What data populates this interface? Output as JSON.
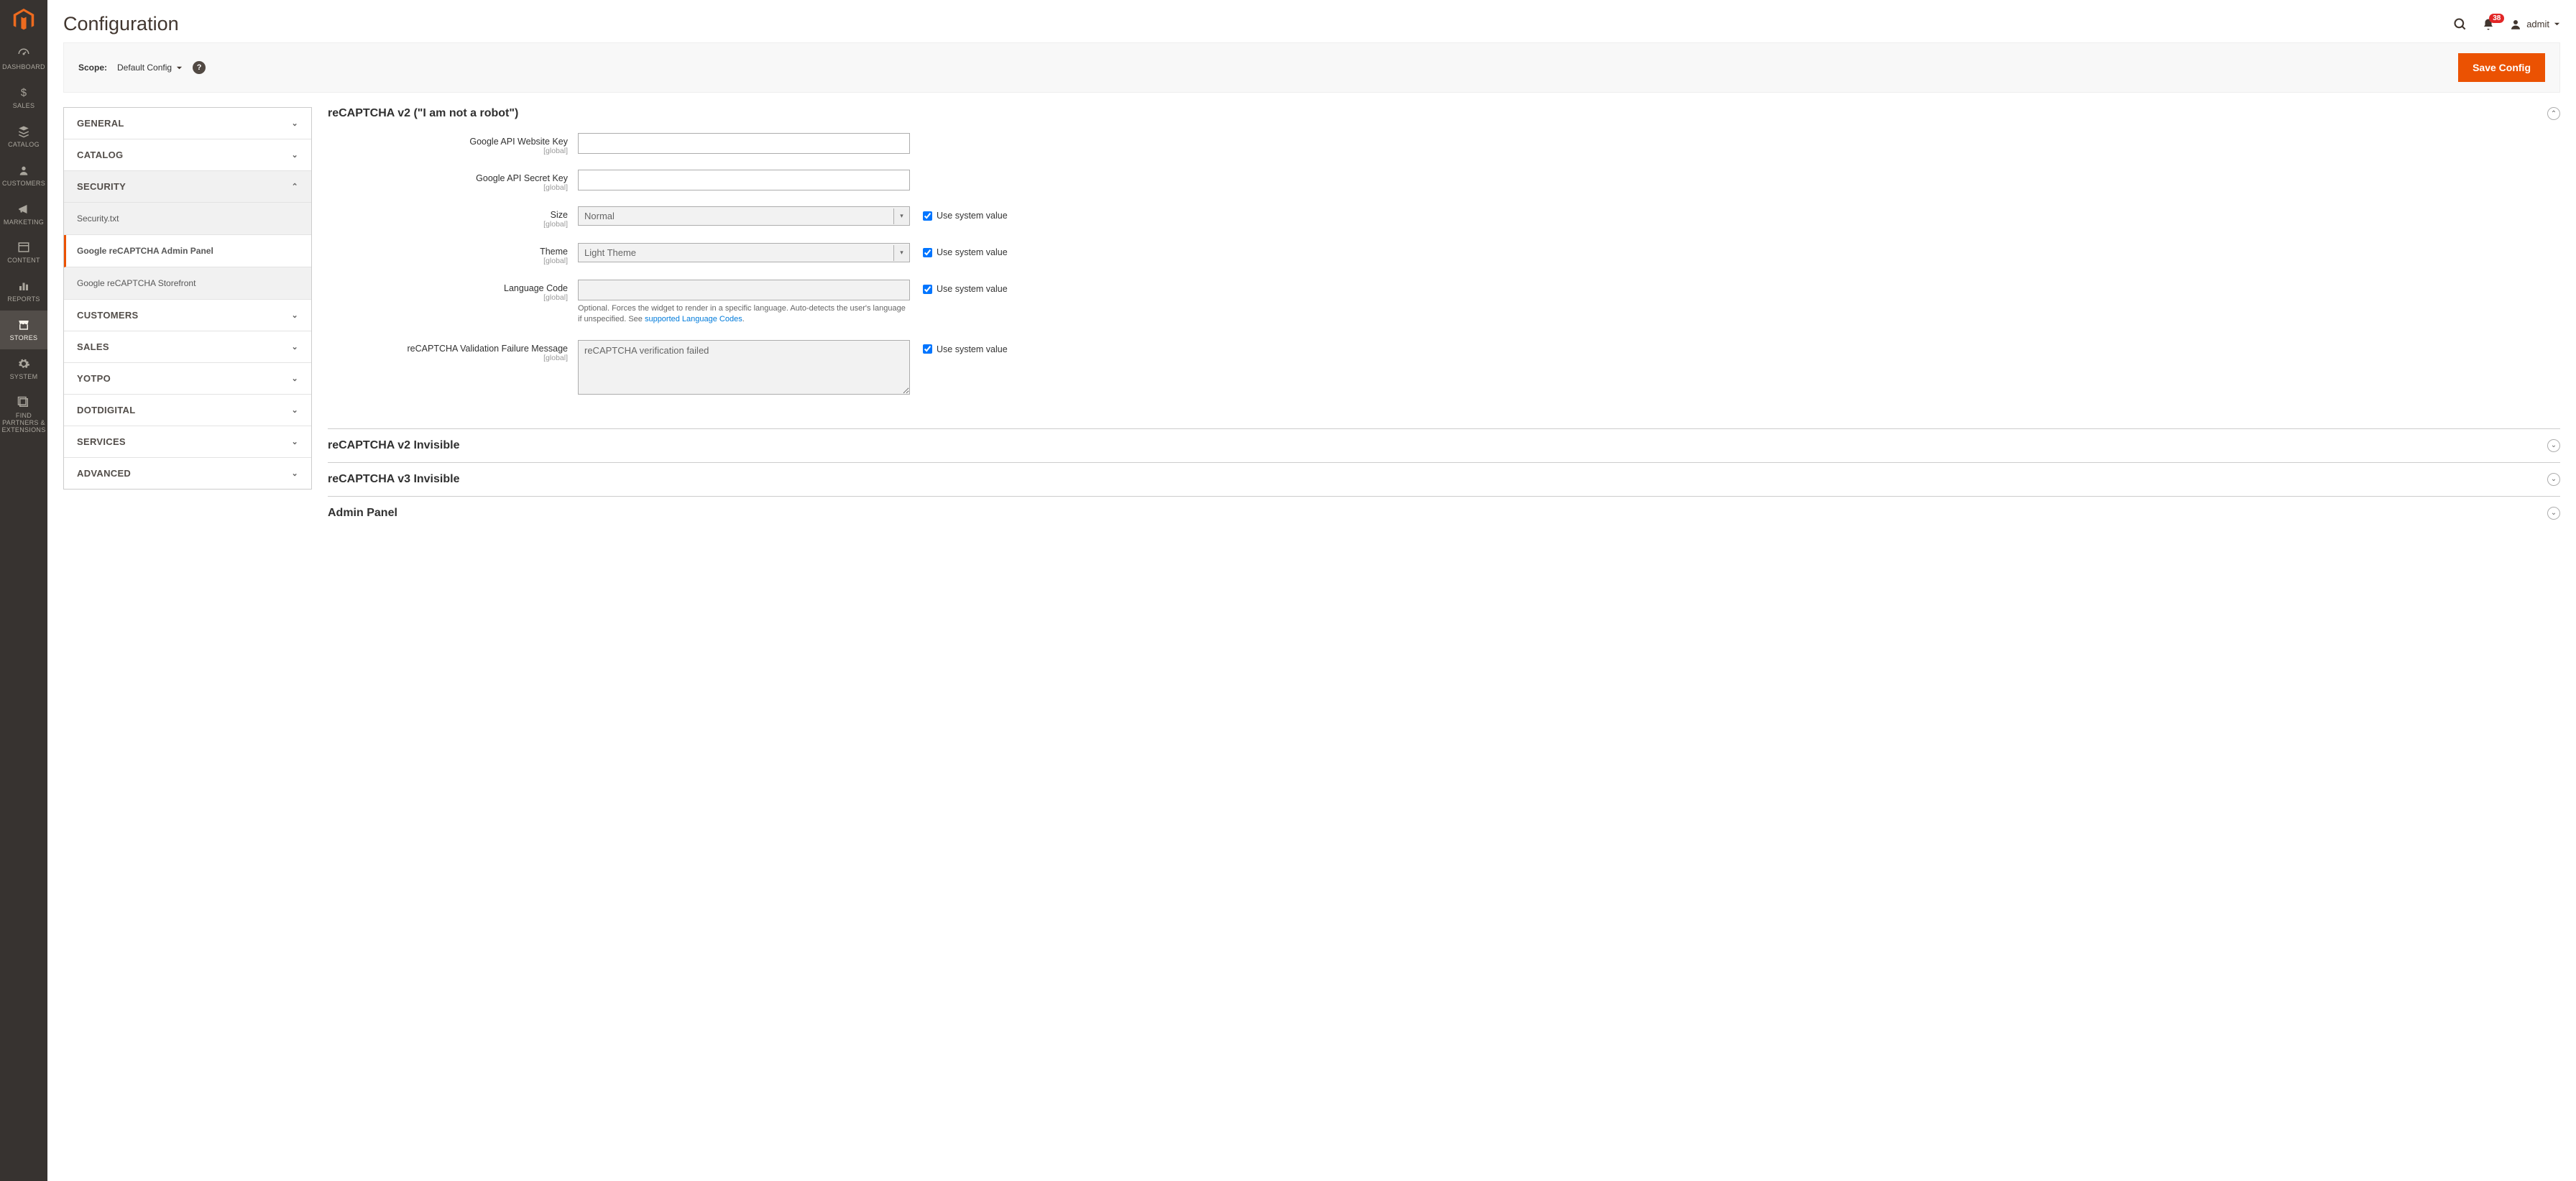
{
  "sidebar": {
    "items": [
      {
        "label": "DASHBOARD"
      },
      {
        "label": "SALES"
      },
      {
        "label": "CATALOG"
      },
      {
        "label": "CUSTOMERS"
      },
      {
        "label": "MARKETING"
      },
      {
        "label": "CONTENT"
      },
      {
        "label": "REPORTS"
      },
      {
        "label": "STORES"
      },
      {
        "label": "SYSTEM"
      },
      {
        "label": "FIND PARTNERS & EXTENSIONS"
      }
    ]
  },
  "header": {
    "title": "Configuration",
    "notifications_count": "38",
    "user_name": "admit"
  },
  "scope": {
    "label": "Scope:",
    "value": "Default Config",
    "save_button": "Save Config"
  },
  "config_tabs": [
    {
      "label": "GENERAL",
      "expanded": false
    },
    {
      "label": "CATALOG",
      "expanded": false
    },
    {
      "label": "SECURITY",
      "expanded": true,
      "children": [
        {
          "label": "Security.txt",
          "active": false
        },
        {
          "label": "Google reCAPTCHA Admin Panel",
          "active": true
        },
        {
          "label": "Google reCAPTCHA Storefront",
          "active": false
        }
      ]
    },
    {
      "label": "CUSTOMERS",
      "expanded": false
    },
    {
      "label": "SALES",
      "expanded": false
    },
    {
      "label": "YOTPO",
      "expanded": false
    },
    {
      "label": "DOTDIGITAL",
      "expanded": false
    },
    {
      "label": "SERVICES",
      "expanded": false
    },
    {
      "label": "ADVANCED",
      "expanded": false
    }
  ],
  "sections": {
    "v2_checkbox": {
      "title": "reCAPTCHA v2 (\"I am not a robot\")",
      "fields": {
        "website_key": {
          "label": "Google API Website Key",
          "scope": "[global]",
          "value": ""
        },
        "secret_key": {
          "label": "Google API Secret Key",
          "scope": "[global]",
          "value": ""
        },
        "size": {
          "label": "Size",
          "scope": "[global]",
          "value": "Normal",
          "use_system": "Use system value"
        },
        "theme": {
          "label": "Theme",
          "scope": "[global]",
          "value": "Light Theme",
          "use_system": "Use system value"
        },
        "language": {
          "label": "Language Code",
          "scope": "[global]",
          "value": "",
          "use_system": "Use system value",
          "note_prefix": "Optional. Forces the widget to render in a specific language. Auto-detects the user's language if unspecified. See ",
          "note_link": "supported Language Codes",
          "note_suffix": "."
        },
        "failure_msg": {
          "label": "reCAPTCHA Validation Failure Message",
          "scope": "[global]",
          "value": "reCAPTCHA verification failed",
          "use_system": "Use system value"
        }
      }
    },
    "v2_invisible": {
      "title": "reCAPTCHA v2 Invisible"
    },
    "v3_invisible": {
      "title": "reCAPTCHA v3 Invisible"
    },
    "admin_panel": {
      "title": "Admin Panel"
    }
  }
}
